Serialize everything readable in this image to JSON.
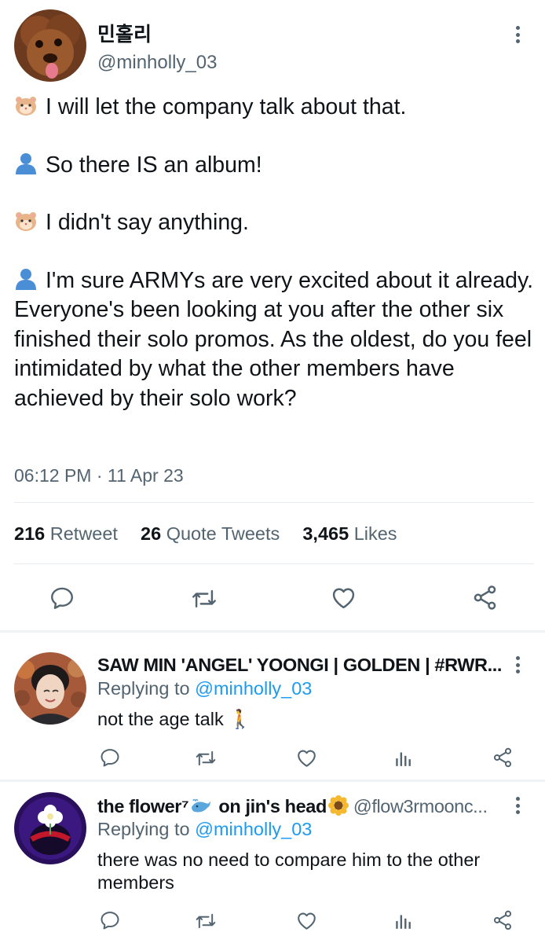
{
  "tweet": {
    "display_name": "민홀리",
    "handle": "@minholly_03",
    "lines": [
      {
        "speaker": "hamster",
        "text": "I will let the company talk about that."
      },
      {
        "speaker": "person",
        "text": "So there IS an album!"
      },
      {
        "speaker": "hamster",
        "text": "I didn't say anything."
      },
      {
        "speaker": "person",
        "text": "I'm sure ARMYs are very excited about it already. Everyone's been looking at you after the other six finished their solo promos. As the oldest, do you feel intimidated by what the other members have achieved by their solo work?"
      }
    ],
    "timestamp": "06:12 PM · 11 Apr 23",
    "stats": {
      "retweets": "216",
      "retweets_label": "Retweet",
      "quotes": "26",
      "quotes_label": "Quote Tweets",
      "likes": "3,465",
      "likes_label": "Likes"
    }
  },
  "replies": [
    {
      "display_name": "SAW MIN 'ANGEL' YOONGI | GOLDEN | #RWR...",
      "replying_prefix": "Replying to",
      "replying_to": "@minholly_03",
      "text": "not the age talk 🚶"
    },
    {
      "display_name_a": "the flower⁷",
      "display_name_b": " on jin's head",
      "handle": "@flow3rmoonc...",
      "replying_prefix": "Replying to",
      "replying_to": "@minholly_03",
      "text": "there was no need to compare him to the other members"
    }
  ],
  "colors": {
    "accent": "#1d9bf0",
    "muted": "#536471",
    "text": "#0f1419"
  },
  "icons": [
    "reply-icon",
    "retweet-icon",
    "like-icon",
    "share-icon",
    "analytics-icon",
    "more-icon"
  ]
}
